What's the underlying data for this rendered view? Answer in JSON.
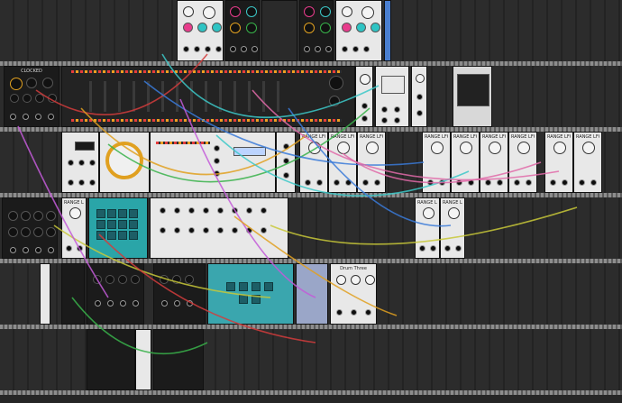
{
  "rack": {
    "rails": [
      "rail-1",
      "rail-2",
      "rail-3",
      "rail-4",
      "rail-5",
      "rail-6"
    ],
    "modules": {
      "clocked": "CLOCKED",
      "range_lfo_1": "RANGE LFO",
      "range_lfo_2": "RANGE LFO",
      "range_lfo_3": "RANGE LFO",
      "range_lfo_4": "RANGE LFO",
      "range_lfo_5": "RANGE LFO",
      "range_lfo_6": "RANGE LFO",
      "range_lfo_7": "RANGE LFO",
      "range_lfo_8": "RANGE LFO",
      "range_lfo_9": "RANGE LFO",
      "range_lfo_10": "RANGE LFO",
      "range_lfo_11": "RANGE LFO",
      "range_lfo_12": "RANGE LFO",
      "drumtroll": "Drum Three"
    }
  },
  "cable_colors": [
    "#d23c3c",
    "#e0a020",
    "#38b24a",
    "#3a7ad8",
    "#c35ad8",
    "#3cc8c8",
    "#e06aa8",
    "#c8c838"
  ]
}
